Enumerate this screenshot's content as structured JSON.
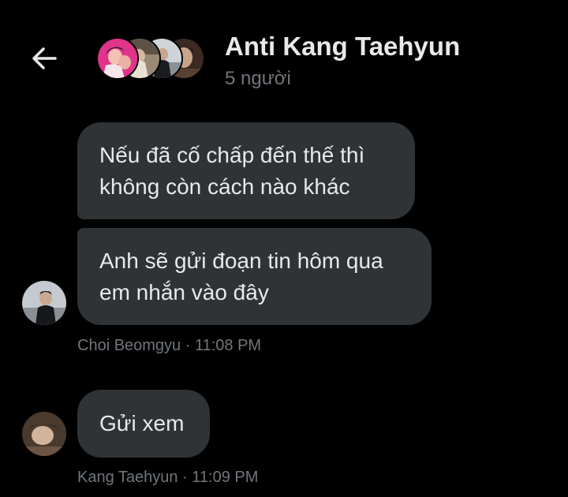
{
  "header": {
    "back_icon": "arrow-left-icon",
    "title": "Anti Kang Taehyun",
    "subtitle": "5 người",
    "avatars": [
      "group-member-avatar-1",
      "group-member-avatar-2",
      "group-member-avatar-3",
      "group-member-avatar-4"
    ]
  },
  "messages": [
    {
      "lines": [
        "Nếu đã cố chấp đến thế thì",
        "không còn cách nào khác"
      ]
    },
    {
      "lines": [
        "Anh sẽ gửi đoạn tin hôm qua",
        "em nhắn vào đây"
      ],
      "meta": "Choi Beomgyu · 11:08 PM"
    },
    {
      "lines": [
        "Gửi xem"
      ],
      "meta": "Kang Taehyun · 11:09 PM"
    }
  ],
  "colors": {
    "background": "#000000",
    "bubble": "#2f3336",
    "text": "#e7e9ea",
    "muted": "#71767b",
    "avatar_pink": "#e0338a"
  }
}
